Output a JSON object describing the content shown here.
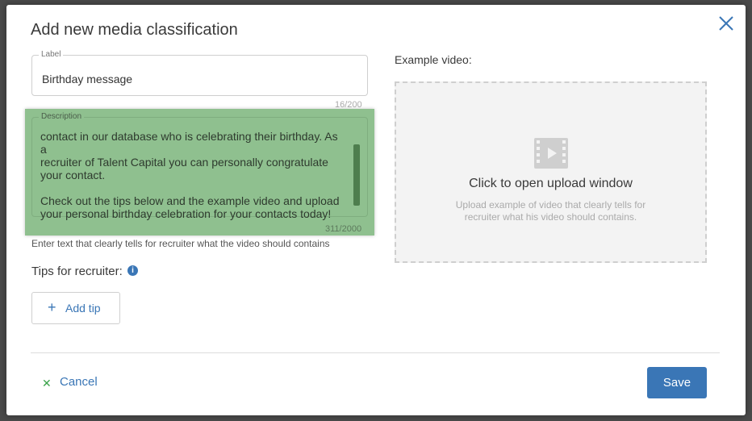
{
  "dialog": {
    "title": "Add new media classification"
  },
  "label_field": {
    "legend": "Label",
    "value": "Birthday message",
    "counter": "16/200"
  },
  "description_field": {
    "legend": "Description",
    "visible_text": "contact in our database who is celebrating their birthday. As a\nrecruiter of Talent Capital you can personally congratulate\nyour contact.\n\nCheck out the tips below and the example video and upload\nyour personal birthday celebration for your contacts today!",
    "counter": "311/2000",
    "helper": "Enter text that clearly tells for recruiter what the video should contains"
  },
  "tips": {
    "label": "Tips for recruiter:",
    "info_icon": "i",
    "add_button_plus": "+",
    "add_button_label": "Add tip"
  },
  "example_video": {
    "label": "Example video:",
    "upload_title": "Click to open upload window",
    "upload_subtitle": "Upload example of video that clearly tells for recruiter what his video should contains."
  },
  "footer": {
    "cancel_icon": "✕",
    "cancel_label": "Cancel",
    "save_label": "Save"
  },
  "colors": {
    "accent": "#3a76b6",
    "highlight": "#8fc08f",
    "cancel_icon": "#3aa34a"
  }
}
